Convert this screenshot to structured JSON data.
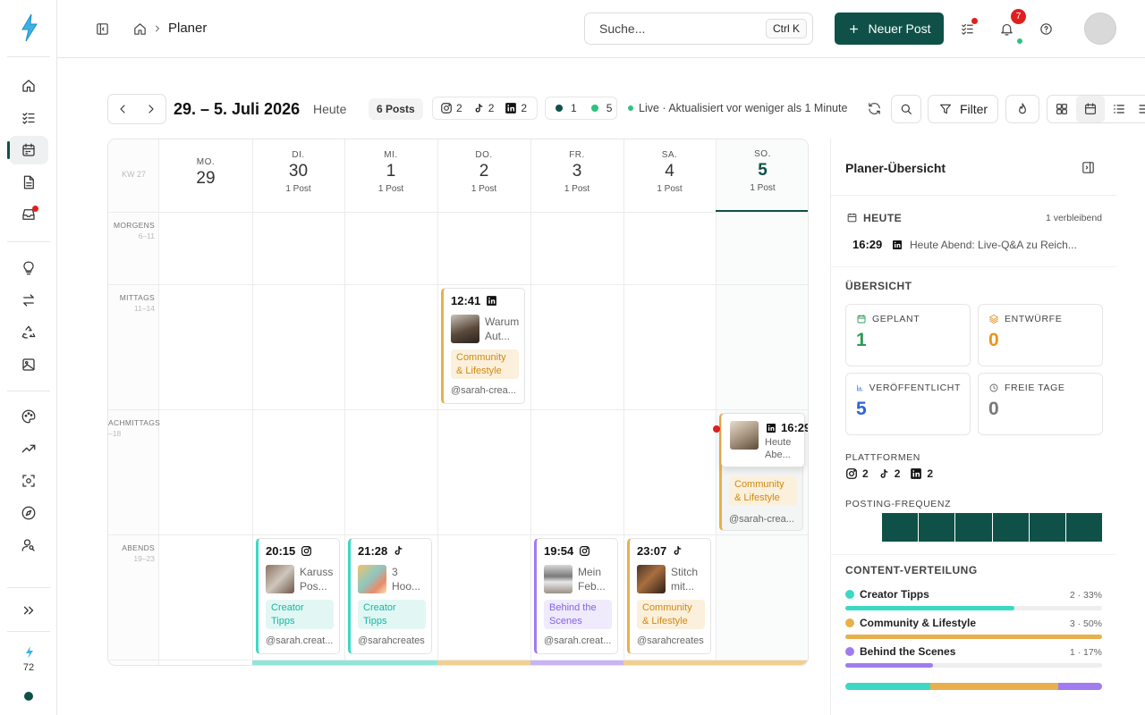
{
  "breadcrumb": {
    "current": "Planer"
  },
  "search": {
    "placeholder": "Suche...",
    "shortcut": "Ctrl K"
  },
  "actions": {
    "new_post": "Neuer Post",
    "notifications_count": "7"
  },
  "sidebar": {
    "credits": "72"
  },
  "toolbar": {
    "date_range": "29. – 5. Juli 2026",
    "today_label": "Heute",
    "posts_badge": "6 Posts",
    "platform_counts": {
      "instagram": "2",
      "tiktok": "2",
      "linkedin": "2"
    },
    "status_counts": {
      "dark": "1",
      "green": "5"
    },
    "live_text": "Live · Aktualisiert vor weniger als 1 Minute",
    "filter_label": "Filter"
  },
  "calendar": {
    "week_label": "KW 27",
    "days": [
      {
        "weekday": "MO.",
        "num": "29",
        "count": ""
      },
      {
        "weekday": "DI.",
        "num": "30",
        "count": "1 Post"
      },
      {
        "weekday": "MI.",
        "num": "1",
        "count": "1 Post"
      },
      {
        "weekday": "DO.",
        "num": "2",
        "count": "1 Post"
      },
      {
        "weekday": "FR.",
        "num": "3",
        "count": "1 Post"
      },
      {
        "weekday": "SA.",
        "num": "4",
        "count": "1 Post"
      },
      {
        "weekday": "SO.",
        "num": "5",
        "count": "1 Post"
      }
    ],
    "slots": [
      {
        "name": "MORGENS",
        "range": "6–11"
      },
      {
        "name": "MITTAGS",
        "range": "11–14"
      },
      {
        "name": "ACHMITTAGS",
        "range": "–18"
      },
      {
        "name": "ABENDS",
        "range": "19–23"
      }
    ],
    "posts": [
      {
        "time": "12:41",
        "platform": "linkedin",
        "title": "Warum Aut...",
        "tag": "Community & Lifestyle",
        "user": "@sarah-crea..."
      },
      {
        "time": "16:29",
        "platform": "linkedin",
        "title": "Heute Abe...",
        "tag": "Community & Lifestyle",
        "user": "@sarah-crea..."
      },
      {
        "time": "20:15",
        "platform": "instagram",
        "title": "Karuss Pos...",
        "tag": "Creator Tipps",
        "user": "@sarah.creat..."
      },
      {
        "time": "21:28",
        "platform": "tiktok",
        "title": "3 Hoo...",
        "tag": "Creator Tipps",
        "user": "@sarahcreates"
      },
      {
        "time": "19:54",
        "platform": "instagram",
        "title": "Mein Feb...",
        "tag": "Behind the Scenes",
        "user": "@sarah.creat..."
      },
      {
        "time": "23:07",
        "platform": "tiktok",
        "title": "Stitch mit...",
        "tag": "Community & Lifestyle",
        "user": "@sarahcreates"
      }
    ]
  },
  "panel": {
    "title": "Planer-Übersicht",
    "today": {
      "label": "HEUTE",
      "remaining": "1 verbleibend",
      "time": "16:29",
      "title": "Heute Abend: Live-Q&A zu Reich..."
    },
    "overview_label": "ÜBERSICHT",
    "stats": [
      {
        "label": "GEPLANT",
        "value": "1",
        "color": "#2e9b55"
      },
      {
        "label": "ENTWÜRFE",
        "value": "0",
        "color": "#e8941c"
      },
      {
        "label": "VERÖFFENTLICHT",
        "value": "5",
        "color": "#2f63d8"
      },
      {
        "label": "FREIE TAGE",
        "value": "0",
        "color": "#777777"
      }
    ],
    "platforms_label": "PLATTFORMEN",
    "platform_counts": {
      "instagram": "2",
      "tiktok": "2",
      "linkedin": "2"
    },
    "frequency_label": "POSTING-FREQUENZ",
    "frequency": [
      0,
      1,
      1,
      1,
      1,
      1,
      1
    ],
    "distribution_label": "CONTENT-VERTEILUNG",
    "distribution": [
      {
        "name": "Creator Tipps",
        "pct_text": "2 · 33%",
        "pct": 33,
        "color": "#3dd8c4"
      },
      {
        "name": "Community & Lifestyle",
        "pct_text": "3 · 50%",
        "pct": 50,
        "color": "#e8b04c"
      },
      {
        "name": "Behind the Scenes",
        "pct_text": "1 · 17%",
        "pct": 17,
        "color": "#a07cf0"
      }
    ]
  },
  "colors": {
    "brand": "#0f5148",
    "accent_red": "#e02020",
    "live_green": "#2ec27e"
  }
}
